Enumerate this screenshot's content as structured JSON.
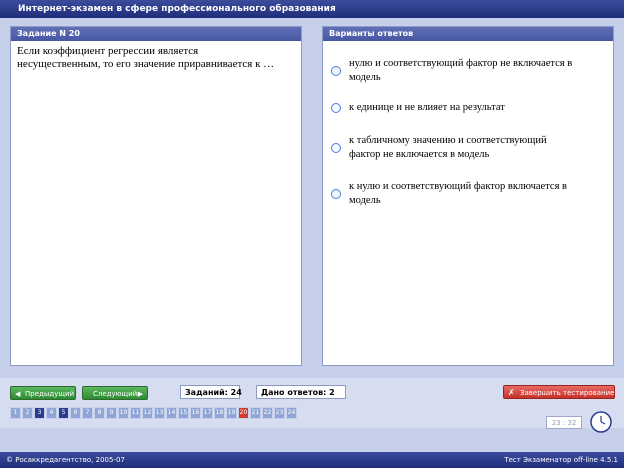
{
  "window": {
    "title": "Интернет-экзамен в сфере профессионального образования"
  },
  "question_panel": {
    "header": "Задание N 20",
    "text_lines": [
      "Если коэффициент регрессии является",
      "несущественным, то его значение приравнивается к  …"
    ]
  },
  "answers_panel": {
    "header": "Варианты ответов",
    "options": [
      {
        "lines": [
          "нулю и соответствующий фактор не включается в",
          "модель"
        ]
      },
      {
        "lines": [
          "к единице и не влияет на результат"
        ]
      },
      {
        "lines": [
          "к табличному значению и соответствующий",
          "фактор не включается в модель"
        ]
      },
      {
        "lines": [
          "к нулю и соответствующий фактор включается в",
          "модель"
        ]
      }
    ]
  },
  "controls": {
    "prev_label": "Предыдущий",
    "next_label": "Следующий",
    "tasks_label": "Заданий: 24",
    "answers_given_label": "Дано ответов: 2",
    "finish_label": "Завершить тестирование"
  },
  "pager": {
    "pages": [
      "1",
      "2",
      "3",
      "4",
      "5",
      "6",
      "7",
      "8",
      "9",
      "10",
      "11",
      "12",
      "13",
      "14",
      "15",
      "16",
      "17",
      "18",
      "19",
      "20",
      "21",
      "22",
      "23",
      "24"
    ],
    "answered": [
      "3",
      "5"
    ],
    "current": "20"
  },
  "timer": {
    "value": "23 : 32"
  },
  "footer": {
    "copyright": "© Росаккредагентство, 2005-07",
    "version": "Тест Экзаменатор off-line 4.5.1"
  },
  "colors": {
    "accent": "#2c3d8f",
    "current_page": "#d33a2c",
    "nav_button": "#3a9a3d",
    "finish_button": "#c6332a"
  },
  "icons": {
    "prev": "arrow-left-icon",
    "next": "arrow-right-icon",
    "finish": "running-man-icon",
    "clock": "clock-icon"
  }
}
